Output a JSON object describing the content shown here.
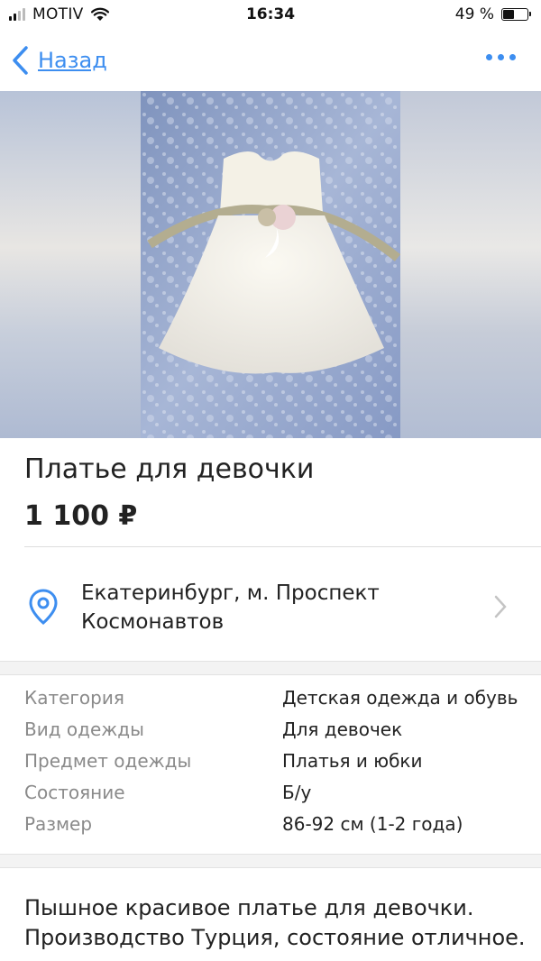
{
  "status_bar": {
    "carrier": "MOTIV",
    "time": "16:34",
    "battery_percent": "49 %",
    "battery_level": 0.49
  },
  "nav": {
    "back_label": "Назад",
    "back_icon": "chevron-left-icon",
    "more_icon": "more-dots-icon"
  },
  "photo": {
    "subject": "white-girls-dress"
  },
  "listing": {
    "title": "Платье для девочки",
    "price": "1 100 ₽"
  },
  "location": {
    "text": "Екатеринбург, м. Проспект Космонавтов",
    "icon": "map-pin-icon"
  },
  "specs": [
    {
      "label": "Категория",
      "value": "Детская одежда и обувь"
    },
    {
      "label": "Вид одежды",
      "value": "Для девочек"
    },
    {
      "label": "Предмет одежды",
      "value": "Платья и юбки"
    },
    {
      "label": "Состояние",
      "value": "Б/у"
    },
    {
      "label": "Размер",
      "value": "86-92 см (1-2 года)"
    }
  ],
  "description": "Пышное красивое платье для девочки. Производство Турция, состояние отличное.",
  "colors": {
    "accent": "#3d8ef0",
    "text": "#222222",
    "muted": "#8a8a8a"
  }
}
